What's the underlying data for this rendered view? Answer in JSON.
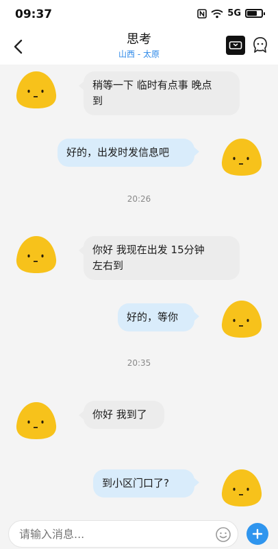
{
  "status_bar": {
    "time": "09:37",
    "signal_text": "5G"
  },
  "header": {
    "title": "思考",
    "subtitle": "山西 - 太原"
  },
  "messages": [
    {
      "side": "in",
      "text_line1": "稍等一下 临时有点事 晚点",
      "text_line2": "到"
    },
    {
      "side": "out",
      "text": "好的，出发时发信息吧"
    },
    {
      "type": "time",
      "text": "20:26"
    },
    {
      "side": "in",
      "text_line1": "你好 我现在出发 15分钟",
      "text_line2": "左右到"
    },
    {
      "side": "out",
      "text": "好的，等你"
    },
    {
      "type": "time",
      "text": "20:35"
    },
    {
      "side": "in",
      "text": "你好 我到了"
    },
    {
      "side": "out",
      "text": "到小区门口了?"
    }
  ],
  "input": {
    "placeholder": "请输入消息..."
  },
  "colors": {
    "accent": "#2f95ee",
    "out_bubble": "#d9ecfb",
    "in_bubble": "#ececec",
    "avatar": "#f7c21b"
  },
  "icons": [
    "back-icon",
    "video-call-icon",
    "profile-icon",
    "emoji-icon",
    "plus-icon",
    "nfc-icon",
    "wifi-icon",
    "battery-icon"
  ]
}
